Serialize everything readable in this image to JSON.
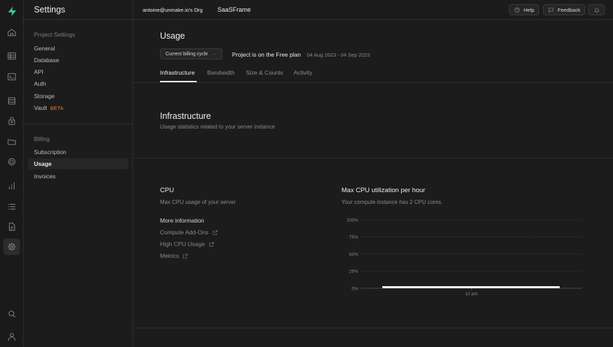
{
  "rail": {
    "icons": [
      "logo-icon",
      "home-icon",
      "table-editor-icon",
      "sql-editor-icon",
      "database-icon",
      "auth-icon",
      "storage-icon",
      "edge-functions-icon",
      "reports-icon",
      "logs-icon",
      "api-docs-icon",
      "settings-icon",
      "search-icon",
      "user-icon"
    ],
    "active": "settings-icon",
    "accent": "#3ecf8e"
  },
  "sidebar": {
    "title": "Settings",
    "project_settings": {
      "heading": "Project Settings",
      "items": [
        {
          "label": "General"
        },
        {
          "label": "Database"
        },
        {
          "label": "API"
        },
        {
          "label": "Auth"
        },
        {
          "label": "Storage"
        },
        {
          "label": "Vault",
          "badge": "BETA"
        }
      ]
    },
    "billing": {
      "heading": "Billing",
      "items": [
        {
          "label": "Subscription"
        },
        {
          "label": "Usage",
          "active": true
        },
        {
          "label": "Invoices"
        }
      ]
    }
  },
  "topbar": {
    "org": "antoine@unmake.io's Org",
    "project": "SaaSFrame",
    "help_label": "Help",
    "feedback_label": "Feedback"
  },
  "main": {
    "title": "Usage",
    "billing_cycle_select": "Current billing cycle",
    "plan_text": "Project is on the Free plan",
    "date_range": "04 Aug 2023 - 04 Sep 2023",
    "tabs": [
      {
        "label": "Infrastructure",
        "active": true
      },
      {
        "label": "Bandwidth"
      },
      {
        "label": "Size & Counts"
      },
      {
        "label": "Activity"
      }
    ],
    "section": {
      "title": "Infrastructure",
      "description": "Usage statistics related to your server instance"
    },
    "cpu": {
      "title": "CPU",
      "description": "Max CPU usage of your server",
      "more_info": "More information",
      "links": [
        {
          "label": "Compute Add-Ons"
        },
        {
          "label": "High CPU Usage"
        },
        {
          "label": "Metrics"
        }
      ]
    },
    "chart_header": {
      "title": "Max CPU utilization per hour",
      "description": "Your compute instance has 2 CPU cores."
    }
  },
  "chart_data": {
    "type": "line",
    "title": "Max CPU utilization per hour",
    "y_ticks": [
      "100%",
      "75%",
      "50%",
      "25%",
      "0%"
    ],
    "ylim": [
      0,
      100
    ],
    "x_ticks": [
      "12 pm"
    ],
    "grid": true,
    "series": [
      {
        "values": [
          0,
          0,
          0,
          0,
          0,
          0,
          0,
          0,
          0,
          0
        ],
        "color": "#ffffff"
      }
    ]
  }
}
